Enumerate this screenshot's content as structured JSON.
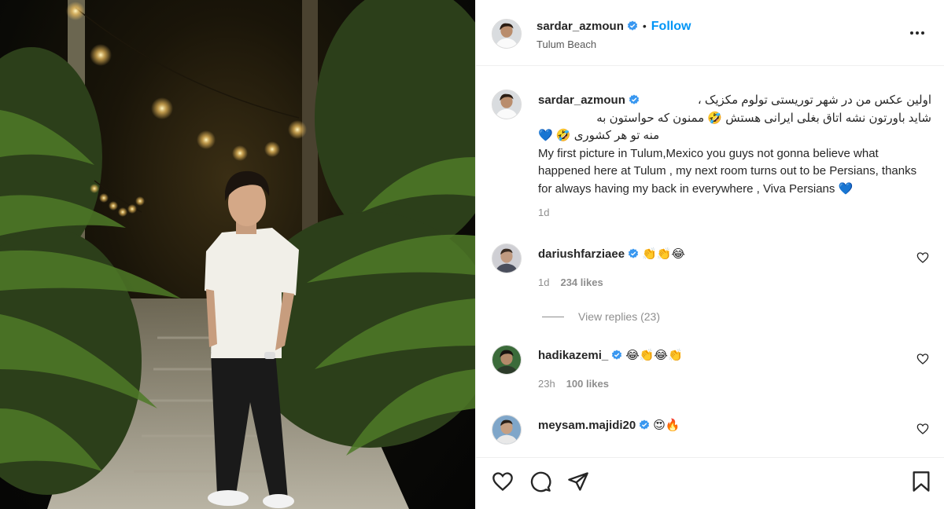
{
  "post": {
    "username": "sardar_azmoun",
    "follow_label": "Follow",
    "dot": "•",
    "location": "Tulum Beach"
  },
  "caption": {
    "username": "sardar_azmoun",
    "fa_line1": "اولین عکس من در شهر توریستی تولوم مکزیک ،",
    "fa_line2": "شاید باورتون نشه اتاق بغلی ایرانی هستش 🤣 ممنون که حواستون به",
    "fa_line3": "منه تو هر کشوری 🤣 💙",
    "en_text": "My first picture in Tulum,Mexico you guys not gonna believe what happened here at Tulum , my next room turns out to be Persians, thanks for always having my back in everywhere , Viva Persians 💙",
    "time": "1d"
  },
  "comments": [
    {
      "username": "dariushfarziaee",
      "text": "👏👏😂",
      "time": "1d",
      "likes": "234 likes"
    },
    {
      "username": "hadikazemi_",
      "text": "😂👏😂👏",
      "time": "23h",
      "likes": "100 likes"
    },
    {
      "username": "meysam.majidi20",
      "text": "😍🔥",
      "time": "",
      "likes": ""
    }
  ],
  "view_replies": "View replies (23)",
  "icons": {
    "more": "more-options-icon",
    "verified": "verified-badge-icon",
    "heart": "heart-icon",
    "comment": "comment-icon",
    "share": "share-icon",
    "save": "save-icon"
  },
  "colors": {
    "link": "#0095f6",
    "verified": "#3897f0",
    "muted": "#8e8e8e",
    "text": "#262626"
  }
}
